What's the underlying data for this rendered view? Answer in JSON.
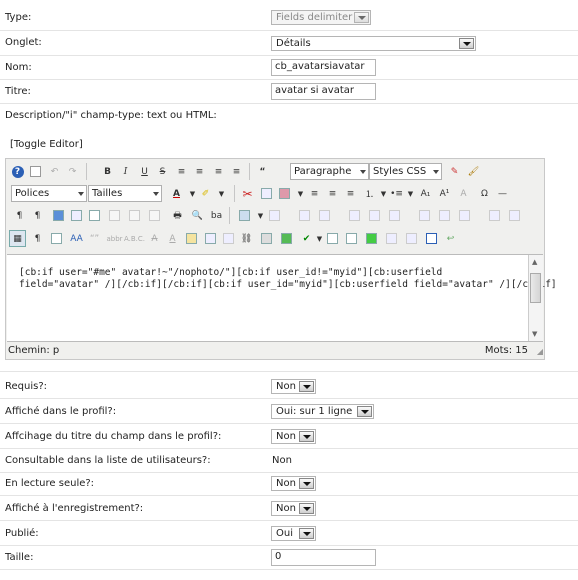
{
  "fields": {
    "type_label": "Type:",
    "type_value": "Fields delimiter",
    "onglet_label": "Onglet:",
    "onglet_value": "Détails",
    "nom_label": "Nom:",
    "nom_value": "cb_avatarsiavatar",
    "titre_label": "Titre:",
    "titre_value": "avatar si avatar",
    "description_label": "Description/\"i\" champ-type: text ou HTML:"
  },
  "editor": {
    "toggle_label": "[Toggle Editor]",
    "format_value": "Paragraphe",
    "styles_value": "Styles CSS",
    "font_value": "Polices",
    "size_value": "Tailles",
    "content_line1": "[cb:if user=\"#me\" avatar!~\"/nophoto/\"][cb:if user_id!=\"myid\"][cb:userfield",
    "content_line2": "field=\"avatar\" /][/cb:if][/cb:if][cb:if user_id=\"myid\"][cb:userfield field=\"avatar\" /][/cb:if]",
    "path_label": "Chemin: p",
    "word_count": "Mots: 15"
  },
  "options": {
    "requis_label": "Requis?:",
    "requis_value": "Non",
    "profil_label": "Affiché dans le profil?:",
    "profil_value": "Oui: sur 1 ligne",
    "titre_profil_label": "Affcihage du titre du champ dans le profil?:",
    "titre_profil_value": "Non",
    "consultable_label": "Consultable dans la liste de utilisateurs?:",
    "consultable_value": "Non",
    "lecture_label": "En lecture seule?:",
    "lecture_value": "Non",
    "enregistrement_label": "Affiché à l'enregistrement?:",
    "enregistrement_value": "Non",
    "publie_label": "Publié:",
    "publie_value": "Oui",
    "taille_label": "Taille:",
    "taille_value": "0"
  },
  "toolbar_icons": [
    "help-icon",
    "new-document-icon",
    "undo-icon",
    "redo-icon",
    "bold-icon",
    "italic-icon",
    "underline-icon",
    "strikethrough-icon",
    "align-left-icon",
    "align-center-icon",
    "align-right-icon",
    "justify-icon",
    "blockquote-icon",
    "clear-format-icon",
    "paint-icon"
  ]
}
